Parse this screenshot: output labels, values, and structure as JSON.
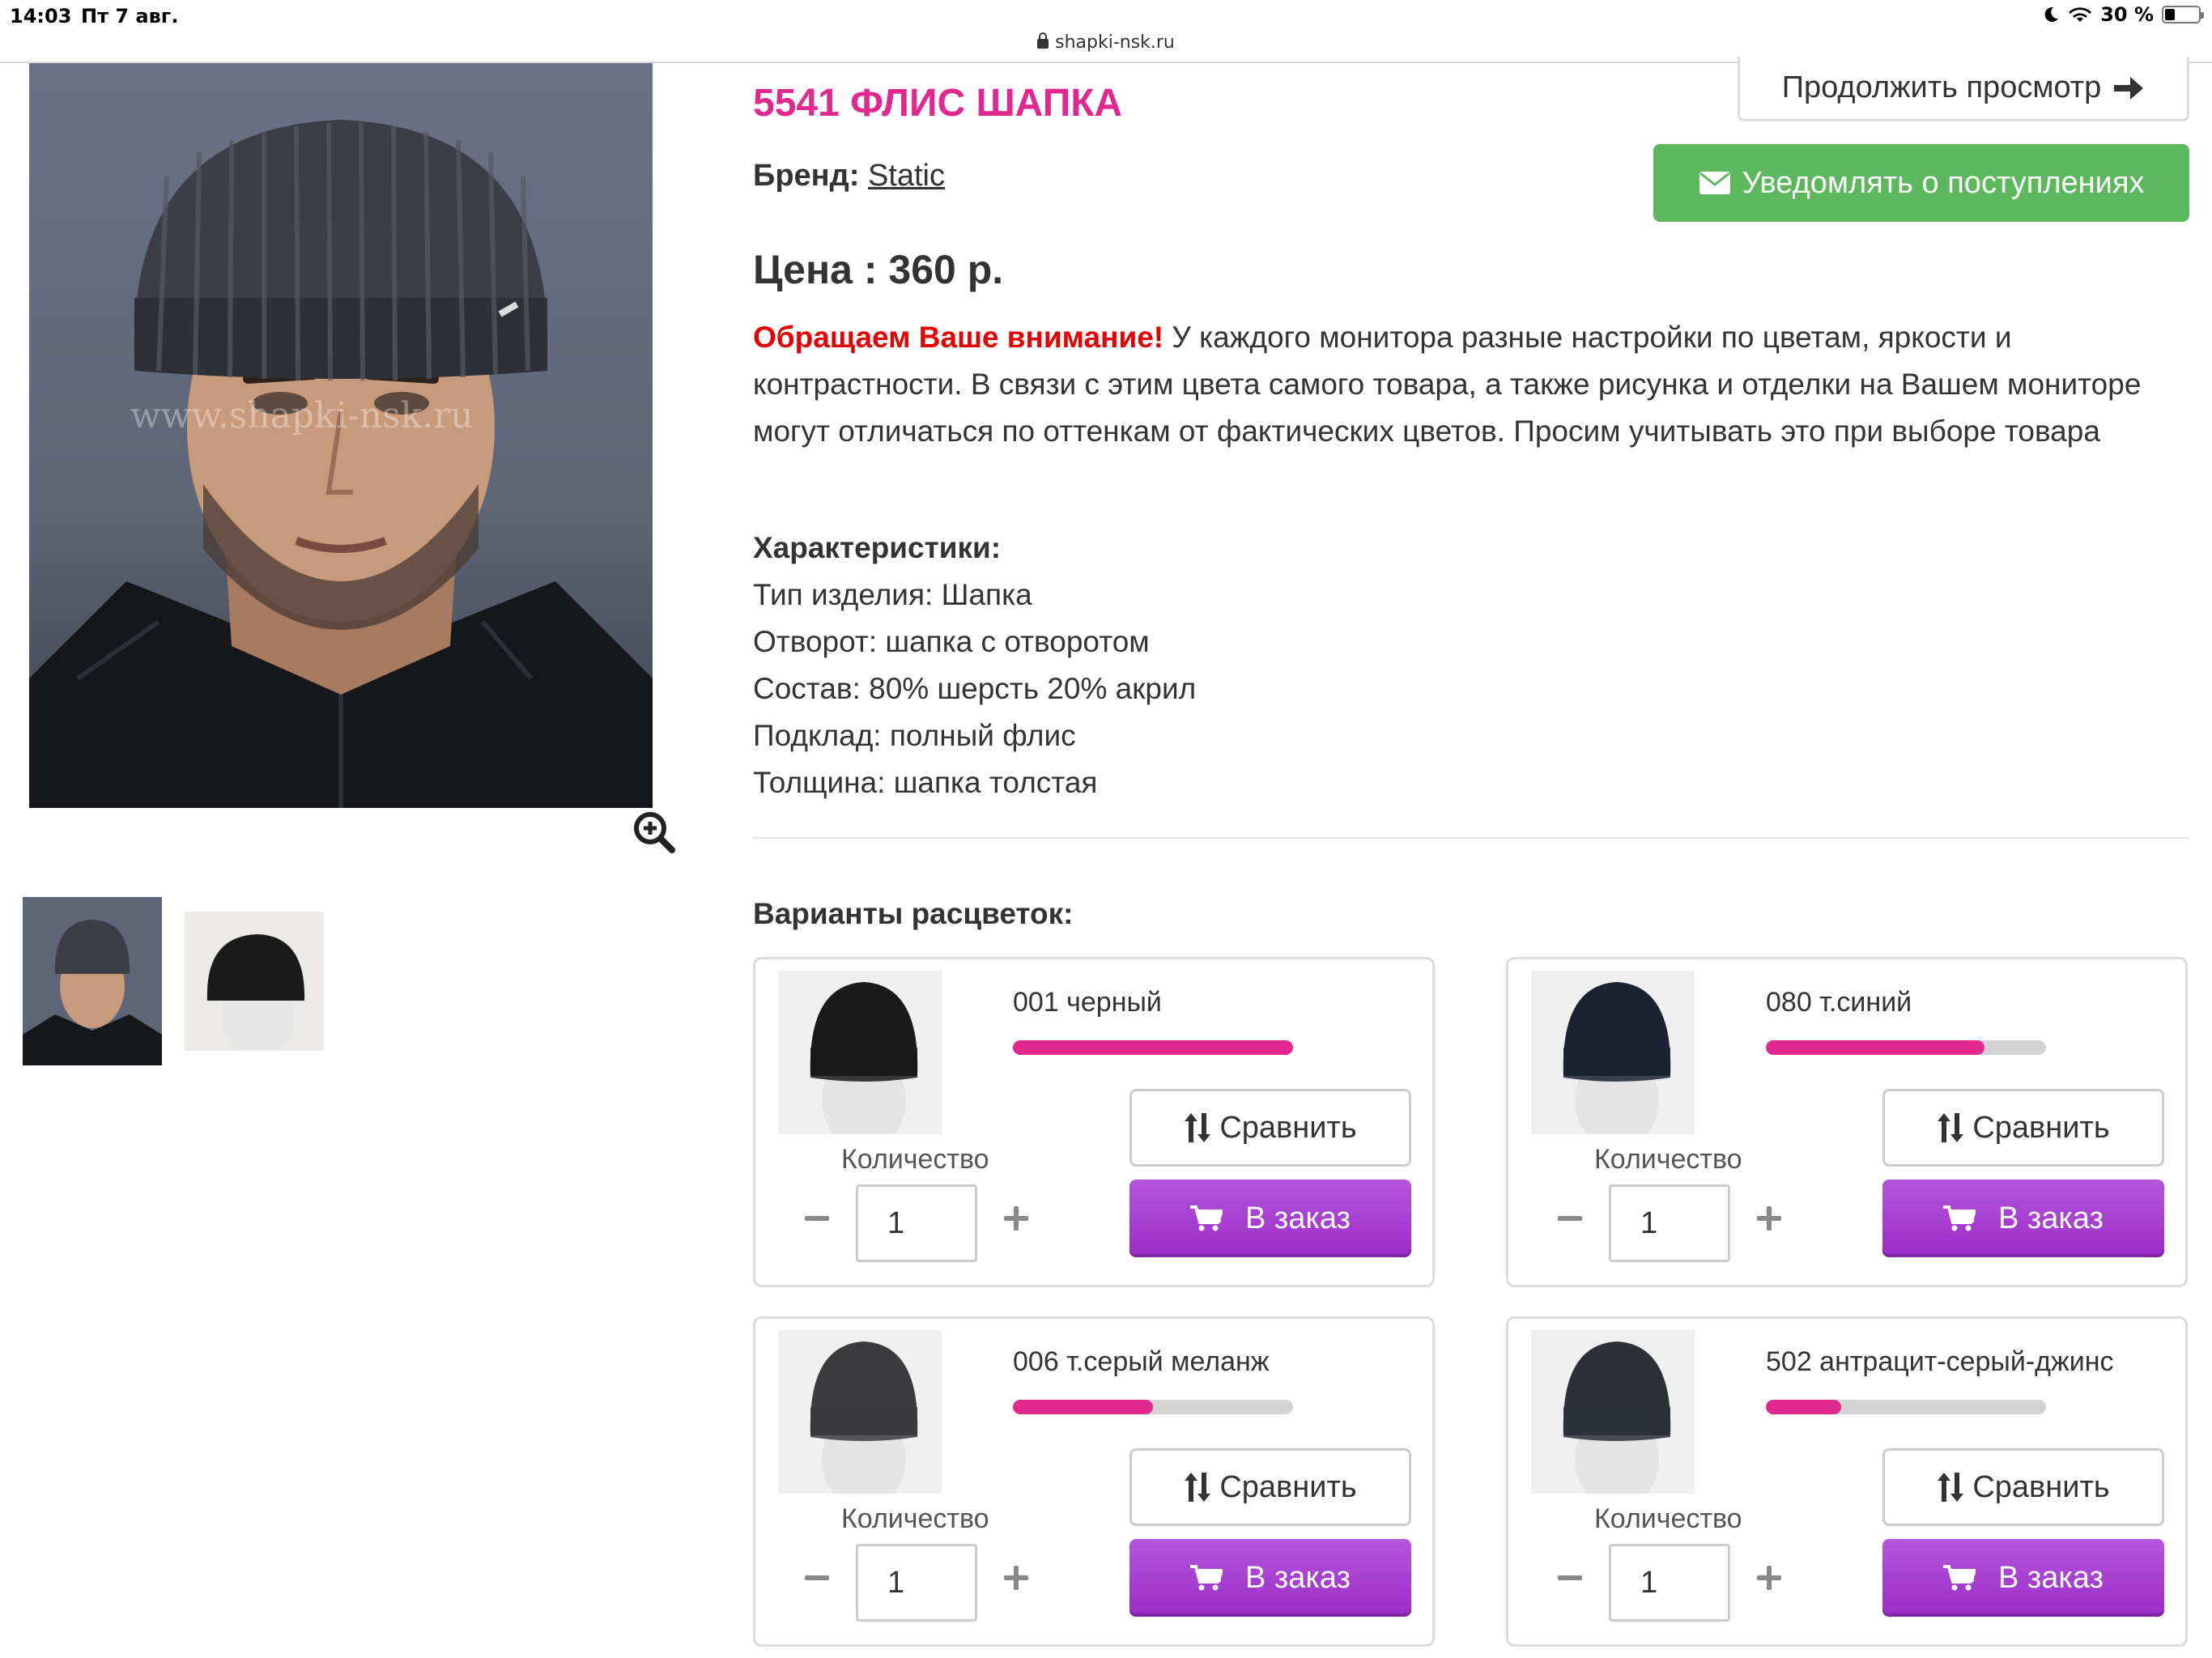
{
  "status_bar": {
    "time": "14:03",
    "date": "Пт 7 авг.",
    "battery": "30 %",
    "battery_level": 0.3
  },
  "address_bar": {
    "url": "shapki-nsk.ru"
  },
  "product": {
    "title": "5541 ФЛИС ШАПКА",
    "brand_label": "Бренд:",
    "brand_value": "Static",
    "price": "Цена : 360 р.",
    "watermark": "www.shapki-nsk.ru"
  },
  "buttons": {
    "continue": "Продолжить просмотр",
    "notify": "Уведомлять о поступлениях"
  },
  "notice": {
    "warning": "Обращаем Ваше внимание!",
    "text": " У каждого монитора разные настройки по цветам, яркости и контрастности. В связи с этим цвета самого товара, а также рисунка и отделки на Вашем мониторе могут отличаться по оттенкам от фактических цветов. Просим учитывать это при выборе товара"
  },
  "specs": {
    "heading": "Характеристики:",
    "items": [
      "Тип изделия: Шапка",
      "Отворот: шапка с отворотом",
      "Состав: 80% шерсть 20% акрил",
      "Подклад: полный флис",
      "Толщина: шапка толстая"
    ]
  },
  "variants": {
    "heading": "Варианты расцветок:",
    "quantity_label": "Количество",
    "compare_label": "Сравнить",
    "order_label": "В заказ",
    "items": [
      {
        "name": "001 черный",
        "stock": 1.0,
        "qty": "1",
        "color": "#1a1a1a"
      },
      {
        "name": "080 т.синий",
        "stock": 0.78,
        "qty": "1",
        "color": "#1b2233"
      },
      {
        "name": "006 т.серый меланж",
        "stock": 0.5,
        "qty": "1",
        "color": "#3b3b3d"
      },
      {
        "name": "502 антрацит-серый-джинс",
        "stock": 0.27,
        "qty": "1",
        "color": "#2d3038"
      }
    ]
  },
  "colors": {
    "accent": "#e2288f",
    "notify_green": "#5cb85c",
    "order_purple": "#a83bd0",
    "warning_red": "#e60000"
  }
}
